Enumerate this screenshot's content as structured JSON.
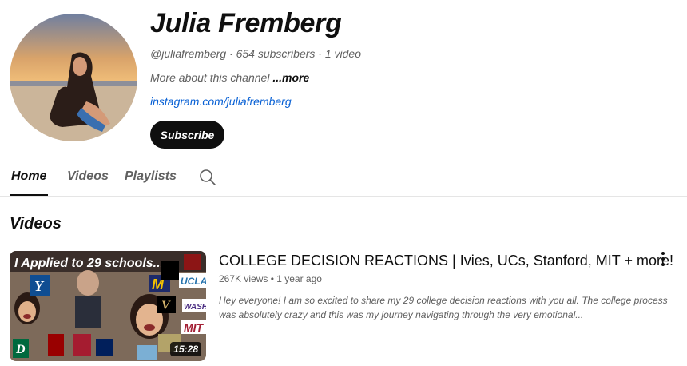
{
  "channel": {
    "name": "Julia Fremberg",
    "meta": "@juliafremberg · 654 subscribers · 1 video",
    "about_prefix": "More about this channel ",
    "about_more": "...more",
    "link": "instagram.com/juliafremberg",
    "subscribe_label": "Subscribe"
  },
  "tabs": [
    {
      "label": "Home"
    },
    {
      "label": "Videos"
    },
    {
      "label": "Playlists"
    }
  ],
  "icons": {
    "search": "search-icon",
    "more": "more-vert-icon"
  },
  "section": {
    "title": "Videos"
  },
  "video": {
    "title": "COLLEGE DECISION REACTIONS | Ivies, UCs, Stanford, MIT + more!",
    "meta": "267K views • 1 year ago",
    "description": "Hey everyone! I am so excited to share my 29 college decision reactions with you all. The college process was absolutely crazy and this was my journey navigating through the very emotional...",
    "duration": "15:28",
    "thumbnail_caption": "I Applied to 29 schools...",
    "thumbnail_logos": [
      "Y",
      "M",
      "UCLA",
      "WASH",
      "MIT",
      "V",
      "D"
    ]
  },
  "colors": {
    "link": "#065fd4",
    "text_secondary": "#606060",
    "button_bg": "#0f0f0f"
  }
}
